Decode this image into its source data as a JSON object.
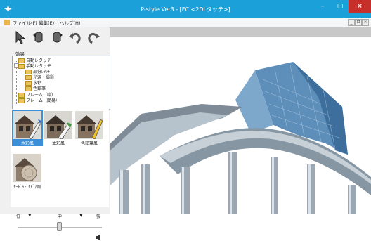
{
  "window": {
    "title": "P-style Ver3 - [FC <2DLタッチ>]",
    "min_label": "–",
    "max_label": "□",
    "close_label": "×"
  },
  "menu": {
    "items": [
      "ファイル(F)",
      "編集(E)",
      "ヘルプ(H)"
    ],
    "mdi_buttons": [
      "_",
      "⊡",
      "×"
    ]
  },
  "tools": [
    "select-tool-icon",
    "rotate-left-tool-icon",
    "rotate-right-tool-icon",
    "undo-icon",
    "redo-icon"
  ],
  "panel": {
    "section_label": "効果",
    "tree": [
      {
        "label": "自動レタッチ",
        "level": 0
      },
      {
        "label": "手動レタッチ",
        "level": 0
      },
      {
        "label": "部分ﾚﾀｯﾁ",
        "level": 1
      },
      {
        "label": "光源・撮影",
        "level": 1
      },
      {
        "label": "水彩",
        "level": 1
      },
      {
        "label": "色鉛筆",
        "level": 1
      },
      {
        "label": "フレーム（枠）",
        "level": 0
      },
      {
        "label": "フレーム（簡易）",
        "level": 0
      }
    ],
    "thumbs": [
      {
        "label": "水彩風",
        "selected": true
      },
      {
        "label": "油彩風",
        "selected": false
      },
      {
        "label": "色鉛筆風",
        "selected": false
      },
      {
        "label": "ｾｰﾄﾞｯﾄﾞｾﾋﾟｱ風",
        "selected": false
      }
    ],
    "slider": {
      "low": "低",
      "mid": "中",
      "high": "強",
      "value": 0.5
    }
  },
  "colors": {
    "titlebar": "#1ca0da",
    "close": "#c7302a",
    "selection": "#3a8fd8"
  }
}
